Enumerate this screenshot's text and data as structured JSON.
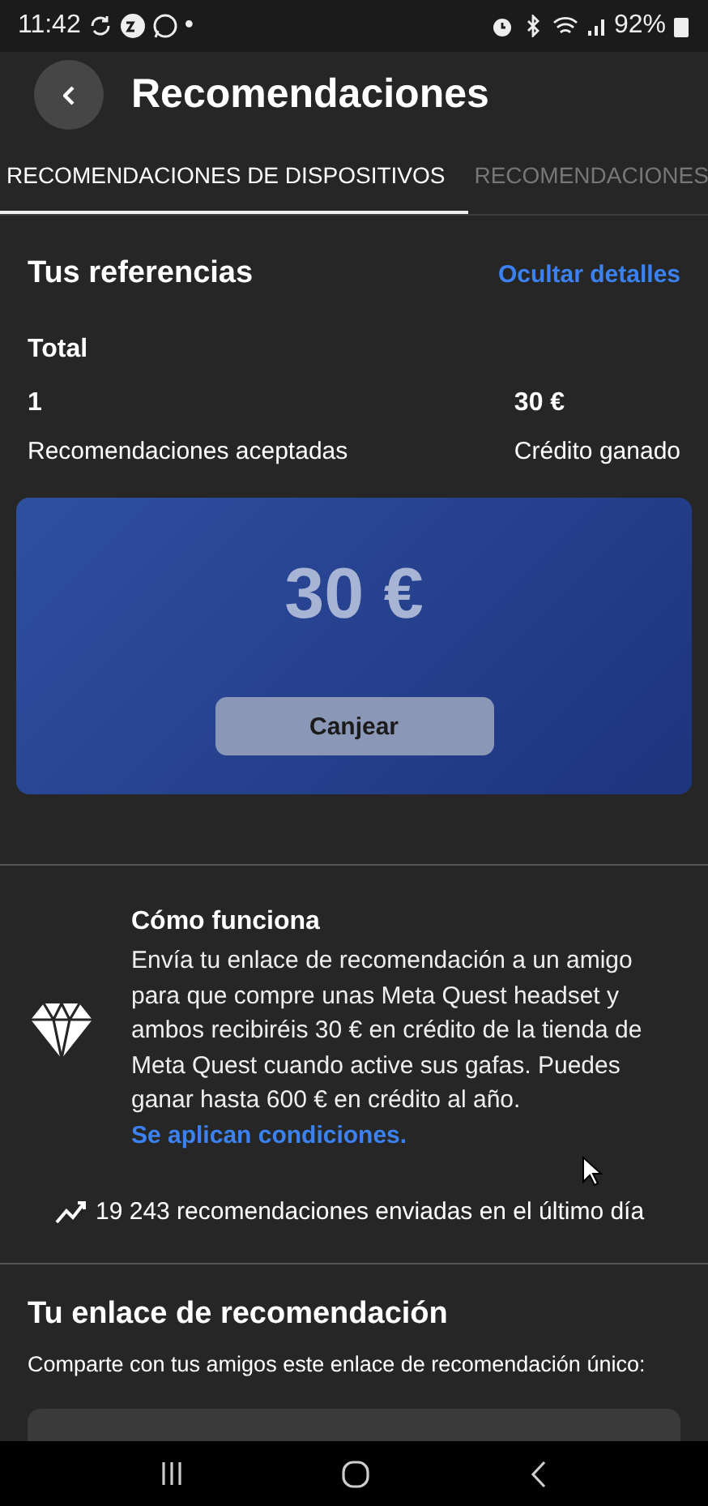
{
  "status_bar": {
    "time": "11:42",
    "dot": "•",
    "battery": "92%"
  },
  "header": {
    "title": "Recomendaciones"
  },
  "tabs": [
    {
      "label": "RECOMENDACIONES DE DISPOSITIVOS",
      "selected": true
    },
    {
      "label": "RECOMENDACIONES",
      "selected": false
    }
  ],
  "referrals": {
    "title": "Tus referencias",
    "toggle_link": "Ocultar detalles",
    "total_label": "Total",
    "stats": [
      {
        "value": "1",
        "label": "Recomendaciones aceptadas"
      },
      {
        "value": "30 €",
        "label": "Crédito ganado"
      }
    ],
    "card": {
      "amount": "30 €",
      "button": "Canjear"
    }
  },
  "how_it_works": {
    "title": "Cómo funciona",
    "text": "Envía tu enlace de recomendación a un amigo para que compre unas Meta Quest headset y ambos recibiréis 30 € en crédito de la tienda de Meta Quest cuando active sus gafas.  Puedes ganar hasta 600 € en crédito al año. ",
    "link": "Se aplican condiciones."
  },
  "stat_line": "19 243 recomendaciones enviadas en el último día",
  "link_section": {
    "title": "Tu enlace de recomendación",
    "description": "Comparte con tus amigos este enlace de recomendación único:"
  }
}
